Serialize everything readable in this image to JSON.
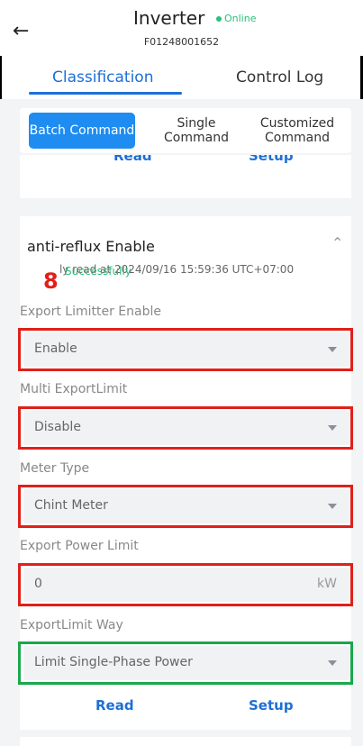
{
  "header": {
    "back_icon": "arrow-left-icon",
    "title": "Inverter",
    "status": "Online",
    "status_color": "#2bbf7a",
    "serial": "F01248001652"
  },
  "tabs": [
    {
      "label": "Classification",
      "active": true
    },
    {
      "label": "Control Log",
      "active": false
    }
  ],
  "command_types": [
    {
      "label": "Batch Command",
      "active": true
    },
    {
      "label": "Single Command",
      "active": false
    },
    {
      "label": "Customized Command",
      "active": false
    }
  ],
  "previous_card": {
    "read_label": "Read",
    "setup_label": "Setup"
  },
  "card": {
    "title": "anti-reflux Enable",
    "read_info": "ly read at 2024/09/16 15:59:36 UTC+07:00",
    "read_result": "Successfully",
    "annotation_number": "8",
    "fields": [
      {
        "label": "Export Limitter Enable",
        "value": "Enable",
        "type": "select"
      },
      {
        "label": "Multi ExportLimit",
        "value": "Disable",
        "type": "select"
      },
      {
        "label": "Meter Type",
        "value": "Chint Meter",
        "type": "select"
      },
      {
        "label": "Export Power Limit",
        "value": "0",
        "unit": "kW",
        "type": "input"
      },
      {
        "label": "ExportLimit Way",
        "value": "Limit Single-Phase Power",
        "type": "select"
      }
    ],
    "read_label": "Read",
    "setup_label": "Setup"
  },
  "colors": {
    "accent": "#1e6fd6",
    "highlight_red": "#e0201a",
    "highlight_green": "#1aa84d",
    "success": "#2bbf7a"
  }
}
